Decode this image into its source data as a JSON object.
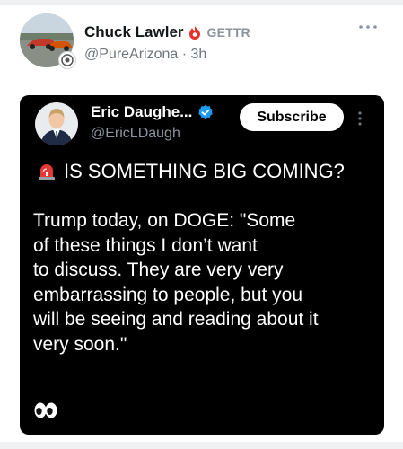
{
  "post": {
    "author_name": "Chuck Lawler",
    "platform_tag": "GETTR",
    "handle": "@PureArizona",
    "separator": "·",
    "time_ago": "3h",
    "more_icon": "ellipsis-icon"
  },
  "embedded": {
    "author_name": "Eric Daughe...",
    "handle": "@EricLDaugh",
    "subscribe_label": "Subscribe",
    "alert_text": "IS SOMETHING BIG COMING?",
    "body_text": "Trump today, on DOGE: \"Some\nof these things I don’t want\nto discuss. They are very very\nembarrassing to people, but you\nwill be seeing and reading about it\nvery soon.\""
  },
  "colors": {
    "gettr_red": "#e8312b",
    "verified_blue": "#1d9bf0",
    "card_bg": "#000000",
    "handle_grey": "#6e767d"
  }
}
